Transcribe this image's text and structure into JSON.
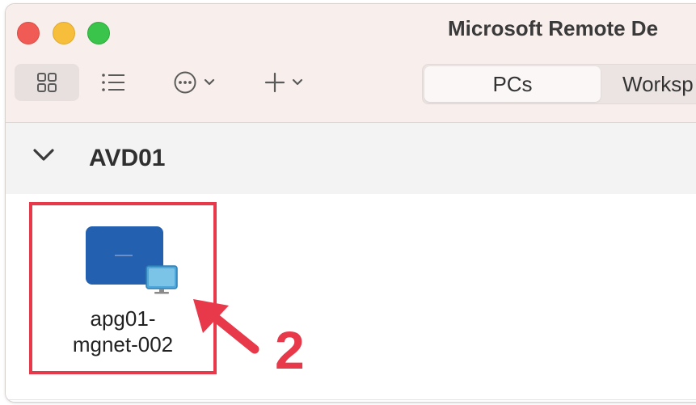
{
  "window": {
    "title": "Microsoft Remote De"
  },
  "toolbar": {
    "view_grid_icon": "grid-view-icon",
    "view_list_icon": "list-view-icon",
    "more_icon": "ellipsis-circle-icon",
    "add_icon": "plus-icon",
    "tabs": [
      {
        "label": "PCs",
        "selected": true
      },
      {
        "label": "Worksp",
        "selected": false
      }
    ]
  },
  "group": {
    "name": "AVD01",
    "expanded": true
  },
  "desktop": {
    "name_line1": "apg01-",
    "name_line2": "mgnet-002",
    "icon": "remote-desktop-icon"
  },
  "annotation": {
    "step": "2",
    "color": "#e8394b"
  }
}
